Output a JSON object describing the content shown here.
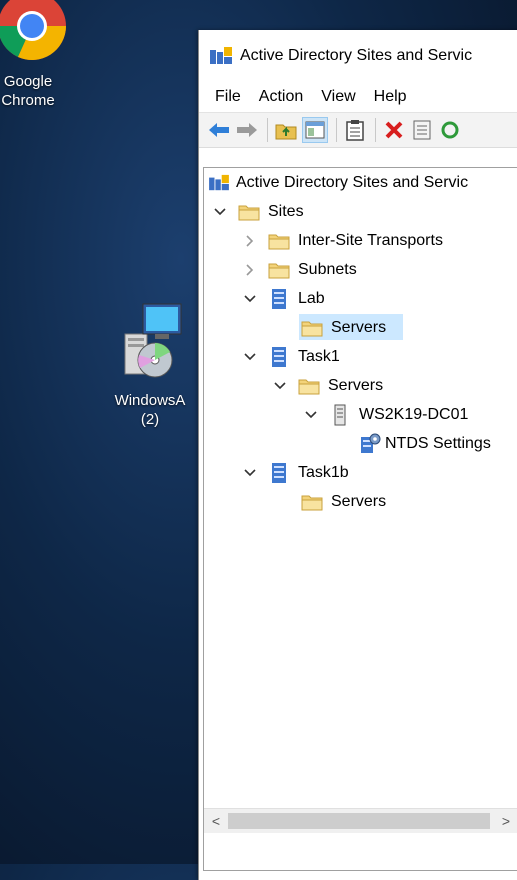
{
  "desktop": {
    "chrome_label_line1": "Google",
    "chrome_label_line2": "Chrome",
    "winapp_label_line1": "WindowsA",
    "winapp_label_line2": "(2)"
  },
  "window": {
    "title": "Active Directory Sites and Servic",
    "menu": [
      "File",
      "Action",
      "View",
      "Help"
    ]
  },
  "tree": {
    "root": "Active Directory Sites and Servic",
    "sites": "Sites",
    "inter_site": "Inter-Site Transports",
    "subnets": "Subnets",
    "lab": "Lab",
    "lab_servers": "Servers",
    "task1": "Task1",
    "task1_servers": "Servers",
    "dc01": "WS2K19-DC01",
    "ntds": "NTDS Settings",
    "task1b": "Task1b",
    "task1b_servers": "Servers"
  },
  "scrollbar": {
    "left": "<",
    "right": ">"
  },
  "colors": {
    "selection": "#cce8ff",
    "desktop": "#0e2747"
  },
  "icons": [
    "back-arrow-icon",
    "forward-arrow-icon",
    "up-folder-icon",
    "show-hide-tree-icon",
    "clipboard-icon",
    "delete-x-icon",
    "properties-icon",
    "refresh-icon",
    "folder-icon",
    "site-icon",
    "server-icon",
    "ntds-settings-icon",
    "chevron-right-icon",
    "chevron-down-icon"
  ]
}
